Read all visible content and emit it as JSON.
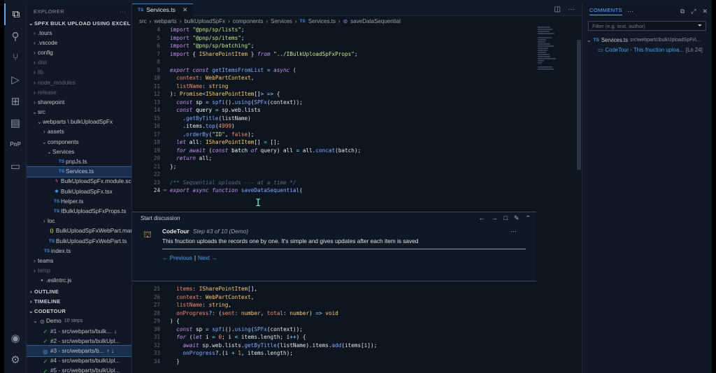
{
  "editor": {
    "tab": "Services.ts",
    "breadcrumb": [
      "src",
      "webparts",
      "bulkUploadSpFx",
      "components",
      "Services",
      "Services.ts",
      "saveDataSequential"
    ],
    "lines_upper": [
      {
        "n": "4",
        "tokens": [
          [
            "kw2",
            "import "
          ],
          [
            "str",
            "\"@pnp/sp/lists\""
          ],
          [
            "pl",
            ";"
          ]
        ]
      },
      {
        "n": "5",
        "tokens": [
          [
            "kw2",
            "import "
          ],
          [
            "str",
            "\"@pnp/sp/items\""
          ],
          [
            "pl",
            ";"
          ]
        ]
      },
      {
        "n": "6",
        "tokens": [
          [
            "kw2",
            "import "
          ],
          [
            "str",
            "\"@pnp/sp/batching\""
          ],
          [
            "pl",
            ";"
          ]
        ]
      },
      {
        "n": "7",
        "tokens": [
          [
            "kw2",
            "import "
          ],
          [
            "pl",
            "{ "
          ],
          [
            "ty",
            "ISharePointItem"
          ],
          [
            "pl",
            " } "
          ],
          [
            "kw",
            "from "
          ],
          [
            "str",
            "\"../IBulkUploadSpFxProps\""
          ],
          [
            "pl",
            ";"
          ]
        ]
      },
      {
        "n": "8",
        "tokens": []
      },
      {
        "n": "9",
        "tokens": [
          [
            "kw",
            "export "
          ],
          [
            "kw",
            "const "
          ],
          [
            "fn",
            "getItemsFromList"
          ],
          [
            "op",
            " = "
          ],
          [
            "kw",
            "async "
          ],
          [
            "pl",
            "("
          ]
        ]
      },
      {
        "n": "10",
        "tokens": [
          [
            "pl",
            "  "
          ],
          [
            "pr",
            "context"
          ],
          [
            "op",
            ": "
          ],
          [
            "ty",
            "WebPartContext"
          ],
          [
            "pl",
            ","
          ]
        ]
      },
      {
        "n": "11",
        "tokens": [
          [
            "pl",
            "  "
          ],
          [
            "pr",
            "listName"
          ],
          [
            "op",
            ": "
          ],
          [
            "ty",
            "string"
          ]
        ]
      },
      {
        "n": "12",
        "tokens": [
          [
            "pl",
            "): "
          ],
          [
            "ty",
            "Promise"
          ],
          [
            "op",
            "<"
          ],
          [
            "ty",
            "ISharePointItem"
          ],
          [
            "pl",
            "[]"
          ],
          [
            "op",
            "> => "
          ],
          [
            "pl",
            "{"
          ]
        ]
      },
      {
        "n": "13",
        "tokens": [
          [
            "pl",
            "  "
          ],
          [
            "kw",
            "const "
          ],
          [
            "vr",
            "sp"
          ],
          [
            "op",
            " = "
          ],
          [
            "fn",
            "spfi"
          ],
          [
            "pl",
            "()."
          ],
          [
            "fn",
            "using"
          ],
          [
            "pl",
            "("
          ],
          [
            "fn",
            "SPFx"
          ],
          [
            "pl",
            "(context));"
          ]
        ]
      },
      {
        "n": "14",
        "tokens": [
          [
            "pl",
            "  "
          ],
          [
            "kw",
            "const "
          ],
          [
            "vr",
            "query"
          ],
          [
            "op",
            " = "
          ],
          [
            "pl",
            "sp.web.lists"
          ]
        ]
      },
      {
        "n": "15",
        "tokens": [
          [
            "pl",
            "    ."
          ],
          [
            "fn",
            "getByTitle"
          ],
          [
            "pl",
            "(listName)"
          ]
        ]
      },
      {
        "n": "16",
        "tokens": [
          [
            "pl",
            "    .items."
          ],
          [
            "fn",
            "top"
          ],
          [
            "pl",
            "("
          ],
          [
            "nm",
            "4999"
          ],
          [
            "pl",
            ")"
          ]
        ]
      },
      {
        "n": "17",
        "tokens": [
          [
            "pl",
            "    ."
          ],
          [
            "fn",
            "orderBy"
          ],
          [
            "pl",
            "("
          ],
          [
            "str",
            "\"ID\""
          ],
          [
            "pl",
            ", "
          ],
          [
            "nm",
            "false"
          ],
          [
            "pl",
            ");"
          ]
        ]
      },
      {
        "n": "18",
        "tokens": [
          [
            "pl",
            "  "
          ],
          [
            "kw",
            "let "
          ],
          [
            "vr",
            "all"
          ],
          [
            "op",
            ": "
          ],
          [
            "ty",
            "ISharePointItem"
          ],
          [
            "pl",
            "[] "
          ],
          [
            "op",
            "= "
          ],
          [
            "pl",
            "[];"
          ]
        ]
      },
      {
        "n": "19",
        "tokens": [
          [
            "pl",
            "  "
          ],
          [
            "kw",
            "for await "
          ],
          [
            "pl",
            "("
          ],
          [
            "kw",
            "const "
          ],
          [
            "vr",
            "batch "
          ],
          [
            "kw",
            "of "
          ],
          [
            "pl",
            "query) all "
          ],
          [
            "op",
            "= "
          ],
          [
            "pl",
            "all."
          ],
          [
            "fn",
            "concat"
          ],
          [
            "pl",
            "(batch);"
          ]
        ]
      },
      {
        "n": "20",
        "tokens": [
          [
            "pl",
            "  "
          ],
          [
            "kw",
            "return "
          ],
          [
            "pl",
            "all;"
          ]
        ]
      },
      {
        "n": "21",
        "tokens": [
          [
            "pl",
            "};"
          ]
        ]
      },
      {
        "n": "22",
        "tokens": []
      },
      {
        "n": "23",
        "tokens": [
          [
            "cm",
            "/** Sequential uploads --- at a time */"
          ]
        ]
      },
      {
        "n": "24",
        "tokens": [
          [
            "kw",
            "export "
          ],
          [
            "kw",
            "async "
          ],
          [
            "kw",
            "function "
          ],
          [
            "fn",
            "saveDataSequential"
          ],
          [
            "pl",
            "("
          ]
        ],
        "current": true,
        "gutter": "comment-gutter-icon"
      }
    ],
    "lines_lower": [
      {
        "n": "25",
        "tokens": [
          [
            "pl",
            "  "
          ],
          [
            "pr",
            "items"
          ],
          [
            "op",
            ": "
          ],
          [
            "ty",
            "ISharePointItem"
          ],
          [
            "pl",
            "[],"
          ]
        ]
      },
      {
        "n": "26",
        "tokens": [
          [
            "pl",
            "  "
          ],
          [
            "pr",
            "context"
          ],
          [
            "op",
            ": "
          ],
          [
            "ty",
            "WebPartContext"
          ],
          [
            "pl",
            ","
          ]
        ]
      },
      {
        "n": "27",
        "tokens": [
          [
            "pl",
            "  "
          ],
          [
            "pr",
            "listName"
          ],
          [
            "op",
            ": "
          ],
          [
            "ty",
            "string"
          ],
          [
            "pl",
            ","
          ]
        ]
      },
      {
        "n": "28",
        "tokens": [
          [
            "pl",
            "  "
          ],
          [
            "pr",
            "onProgress"
          ],
          [
            "op",
            "?: "
          ],
          [
            "pl",
            "("
          ],
          [
            "pr",
            "sent"
          ],
          [
            "op",
            ": "
          ],
          [
            "ty",
            "number"
          ],
          [
            "pl",
            ", "
          ],
          [
            "pr",
            "total"
          ],
          [
            "op",
            ": "
          ],
          [
            "ty",
            "number"
          ],
          [
            "pl",
            ") "
          ],
          [
            "op",
            "=> "
          ],
          [
            "ty",
            "void"
          ]
        ]
      },
      {
        "n": "29",
        "tokens": [
          [
            "pl",
            ") {"
          ]
        ]
      },
      {
        "n": "30",
        "tokens": [
          [
            "pl",
            "  "
          ],
          [
            "kw",
            "const "
          ],
          [
            "vr",
            "sp"
          ],
          [
            "op",
            " = "
          ],
          [
            "fn",
            "spfi"
          ],
          [
            "pl",
            "()."
          ],
          [
            "fn",
            "using"
          ],
          [
            "pl",
            "("
          ],
          [
            "fn",
            "SPFx"
          ],
          [
            "pl",
            "(context));"
          ]
        ]
      },
      {
        "n": "31",
        "tokens": [
          [
            "pl",
            "  "
          ],
          [
            "kw",
            "for "
          ],
          [
            "pl",
            "("
          ],
          [
            "kw",
            "let "
          ],
          [
            "vr",
            "i"
          ],
          [
            "op",
            " = "
          ],
          [
            "nm",
            "0"
          ],
          [
            "pl",
            "; i "
          ],
          [
            "op",
            "< "
          ],
          [
            "pl",
            "items.length; i"
          ],
          [
            "op",
            "++"
          ],
          [
            "pl",
            ") {"
          ]
        ]
      },
      {
        "n": "32",
        "tokens": [
          [
            "pl",
            "    "
          ],
          [
            "kw",
            "await "
          ],
          [
            "pl",
            "sp.web.lists."
          ],
          [
            "fn",
            "getByTitle"
          ],
          [
            "pl",
            "(listName).items."
          ],
          [
            "fn",
            "add"
          ],
          [
            "pl",
            "(items[i]);"
          ]
        ]
      },
      {
        "n": "33",
        "tokens": [
          [
            "pl",
            "    "
          ],
          [
            "fn",
            "onProgress"
          ],
          [
            "pl",
            "?.(i "
          ],
          [
            "op",
            "+ "
          ],
          [
            "nm",
            "1"
          ],
          [
            "pl",
            ", items.length);"
          ]
        ]
      },
      {
        "n": "34",
        "tokens": [
          [
            "pl",
            "  }"
          ]
        ]
      }
    ]
  },
  "discussion": {
    "title": "Start discussion",
    "author": "CodeTour",
    "step": "Step #3 of 10 (Demo)",
    "body": "This fnuction uploads the records one by one. It's simple and gives updates after each item is saved",
    "previous": "← Previous",
    "separator": "|",
    "next": "Next →"
  },
  "explorer": {
    "header": "EXPLORER",
    "project": "SPFX BULK UPLOAD USING EXCEL",
    "rows": [
      {
        "indent": 1,
        "chev": "›",
        "icon": "",
        "label": ".tours"
      },
      {
        "indent": 1,
        "chev": "›",
        "icon": "",
        "label": ".vscode"
      },
      {
        "indent": 1,
        "chev": "›",
        "icon": "",
        "label": "config"
      },
      {
        "indent": 1,
        "chev": "›",
        "icon": "",
        "label": "dist",
        "dim": true
      },
      {
        "indent": 1,
        "chev": "›",
        "icon": "",
        "label": "lib",
        "dim": true
      },
      {
        "indent": 1,
        "chev": "›",
        "icon": "",
        "label": "node_modules",
        "dim": true
      },
      {
        "indent": 1,
        "chev": "›",
        "icon": "",
        "label": "release",
        "dim": true
      },
      {
        "indent": 1,
        "chev": "›",
        "icon": "",
        "label": "sharepoint"
      },
      {
        "indent": 1,
        "chev": "⌄",
        "icon": "",
        "label": "src"
      },
      {
        "indent": 2,
        "chev": "⌄",
        "icon": "",
        "label": "webparts \\ bulkUploadSpFx"
      },
      {
        "indent": 3,
        "chev": "›",
        "icon": "",
        "label": "assets"
      },
      {
        "indent": 3,
        "chev": "⌄",
        "icon": "",
        "label": "components"
      },
      {
        "indent": 4,
        "chev": "⌄",
        "icon": "",
        "label": "Services"
      },
      {
        "indent": 5,
        "chev": "",
        "icon": "TS",
        "cls": "ts",
        "label": "pnpJs.ts"
      },
      {
        "indent": 5,
        "chev": "",
        "icon": "TS",
        "cls": "ts",
        "label": "Services.ts",
        "sel": true
      },
      {
        "indent": 4,
        "chev": "",
        "icon": "ϟ",
        "cls": "scss",
        "label": "BulkUploadSpFx.module.scss"
      },
      {
        "indent": 4,
        "chev": "",
        "icon": "⚛",
        "cls": "tsx",
        "label": "BulkUploadSpFx.tsx"
      },
      {
        "indent": 4,
        "chev": "",
        "icon": "TS",
        "cls": "ts",
        "label": "Helper.ts"
      },
      {
        "indent": 4,
        "chev": "",
        "icon": "TS",
        "cls": "ts",
        "label": "IBulkUploadSpFxProps.ts"
      },
      {
        "indent": 3,
        "chev": "›",
        "icon": "",
        "label": "loc"
      },
      {
        "indent": 3,
        "chev": "",
        "icon": "{}",
        "cls": "json",
        "label": "BulkUploadSpFxWebPart.manif..."
      },
      {
        "indent": 3,
        "chev": "",
        "icon": "TS",
        "cls": "ts",
        "label": "BulkUploadSpFxWebPart.ts"
      },
      {
        "indent": 2,
        "chev": "",
        "icon": "TS",
        "cls": "ts",
        "label": "index.ts"
      },
      {
        "indent": 1,
        "chev": "›",
        "icon": "",
        "label": "teams"
      },
      {
        "indent": 1,
        "chev": "›",
        "icon": "",
        "label": "temp",
        "dim": true
      },
      {
        "indent": 1,
        "chev": "",
        "icon": "●",
        "cls": "eslint",
        "label": ".eslintrc.js"
      }
    ],
    "outline": "OUTLINE",
    "timeline": "TIMELINE",
    "codetour": "CODETOUR",
    "tour_name": "Demo",
    "tour_steps": "10 steps",
    "steps": [
      {
        "label": "#1 - src/webparts/bulk...",
        "mark": "check",
        "arrow": "↓"
      },
      {
        "label": "#2 - src/webparts/bulkUpl...",
        "mark": "check",
        "arrow": ""
      },
      {
        "label": "#3 - src/webparts/b...",
        "mark": "target",
        "arrow": "↑ ↓",
        "sel": true
      },
      {
        "label": "#4 - src/webparts/bulkUpl...",
        "mark": "check",
        "arrow": ""
      },
      {
        "label": "#5 - src/webparts/bulkUpl...",
        "mark": "check",
        "arrow": ""
      }
    ]
  },
  "panel": {
    "tab": "COMMENTS",
    "filter_placeholder": "Filter (e.g. text, author)",
    "file": "Services.ts",
    "file_path": "src\\webparts\\bulkUploadSpFx\\...",
    "thread_text": "CodeTour - This fnuction uploa...",
    "thread_line": "[Ln 24]"
  }
}
